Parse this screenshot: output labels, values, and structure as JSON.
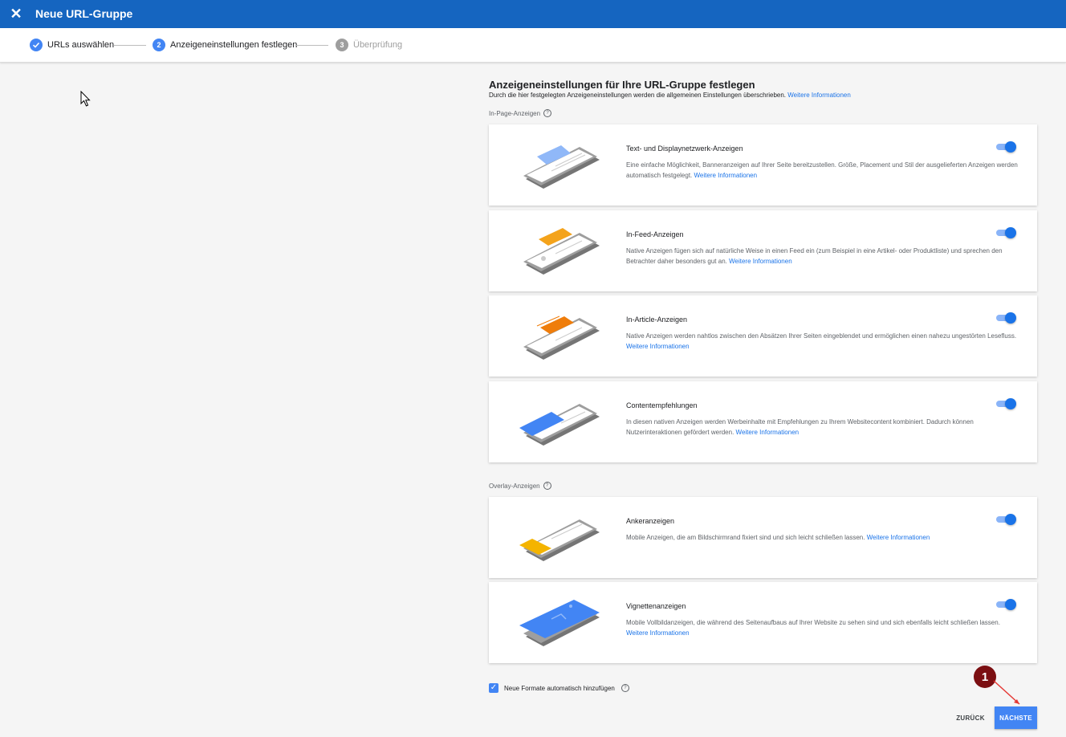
{
  "header": {
    "title": "Neue URL-Gruppe"
  },
  "stepper": {
    "steps": [
      {
        "num": "",
        "label": "URLs auswählen",
        "state": "done"
      },
      {
        "num": "2",
        "label": "Anzeigeneinstellungen festlegen",
        "state": "active"
      },
      {
        "num": "3",
        "label": "Überprüfung",
        "state": "pending"
      }
    ]
  },
  "main": {
    "heading": "Anzeigeneinstellungen für Ihre URL-Gruppe festlegen",
    "subtitle": "Durch die hier festgelegten Anzeigeneinstellungen werden die allgemeinen Einstellungen überschrieben.",
    "subtitle_link": "Weitere Informationen"
  },
  "sections": {
    "inpage_label": "In-Page-Anzeigen",
    "overlay_label": "Overlay-Anzeigen"
  },
  "cards": [
    {
      "title": "Text- und Displaynetzwerk-Anzeigen",
      "desc": "Eine einfache Möglichkeit, Banneranzeigen auf Ihrer Seite bereitzustellen. Größe, Placement und Stil der ausgelieferten Anzeigen werden automatisch festgelegt.",
      "link": "Weitere Informationen",
      "enabled": true
    },
    {
      "title": "In-Feed-Anzeigen",
      "desc": "Native Anzeigen fügen sich auf natürliche Weise in einen Feed ein (zum Beispiel in eine Artikel- oder Produktliste) und sprechen den Betrachter daher besonders gut an.",
      "link": "Weitere Informationen",
      "enabled": true
    },
    {
      "title": "In-Article-Anzeigen",
      "desc": "Native Anzeigen werden nahtlos zwischen den Absätzen Ihrer Seiten eingeblendet und ermöglichen einen nahezu ungestörten Lesefluss.",
      "link": "Weitere Informationen",
      "enabled": true
    },
    {
      "title": "Contentempfehlungen",
      "desc": "In diesen nativen Anzeigen werden Werbeinhalte mit Empfehlungen zu Ihrem Websitecontent kombiniert. Dadurch können Nutzerinteraktionen gefördert werden.",
      "link": "Weitere Informationen",
      "enabled": true
    },
    {
      "title": "Ankeranzeigen",
      "desc": "Mobile Anzeigen, die am Bildschirmrand fixiert sind und sich leicht schließen lassen.",
      "link": "Weitere Informationen",
      "enabled": true
    },
    {
      "title": "Vignettenanzeigen",
      "desc": "Mobile Vollbildanzeigen, die während des Seitenaufbaus auf Ihrer Website zu sehen sind und sich ebenfalls leicht schließen lassen.",
      "link": "Weitere Informationen",
      "enabled": true
    }
  ],
  "footer": {
    "auto_formats_label": "Neue Formate automatisch hinzufügen",
    "auto_formats_checked": true,
    "back_label": "ZURÜCK",
    "next_label": "NÄCHSTE"
  },
  "annotation": {
    "badge": "1"
  },
  "colors": {
    "header": "#1565c0",
    "accent": "#4285f4",
    "link": "#1a73e8",
    "badge": "#7b0f12"
  }
}
